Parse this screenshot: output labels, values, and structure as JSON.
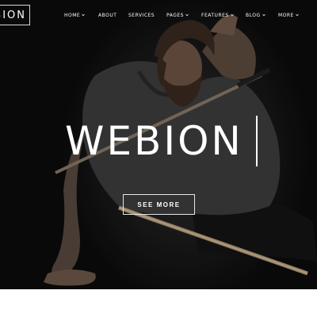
{
  "logo": {
    "text": "BION"
  },
  "nav": {
    "items": [
      {
        "label": "HOME",
        "dropdown": true
      },
      {
        "label": "ABOUT",
        "dropdown": false
      },
      {
        "label": "SERVICES",
        "dropdown": false
      },
      {
        "label": "PAGES",
        "dropdown": true
      },
      {
        "label": "FEATURES",
        "dropdown": true
      },
      {
        "label": "BLOG",
        "dropdown": true
      },
      {
        "label": "MORE",
        "dropdown": true
      }
    ]
  },
  "hero": {
    "title": "WEBION",
    "button_label": "SEE MORE"
  },
  "colors": {
    "hero_background": "#0b0b0b",
    "text": "#ffffff",
    "page_background": "#ffffff"
  }
}
